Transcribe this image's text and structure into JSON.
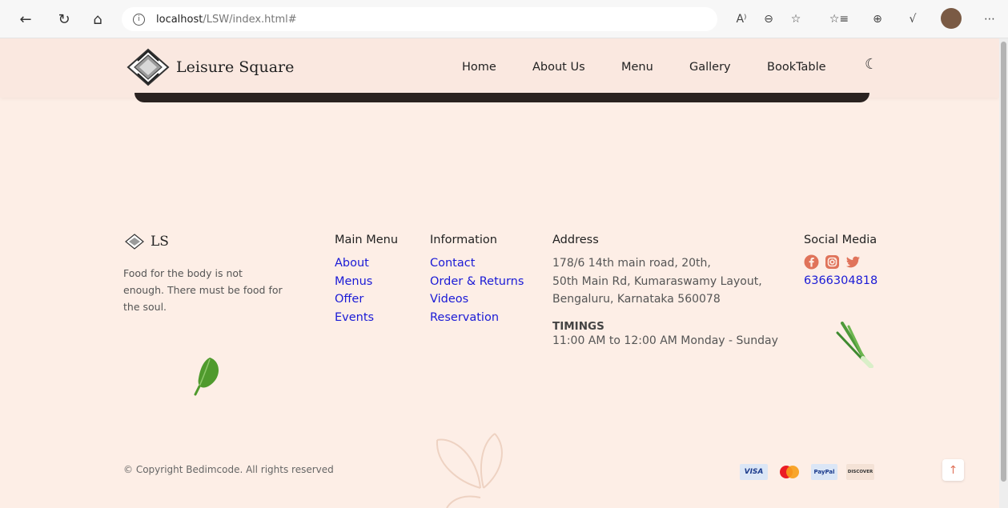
{
  "browser": {
    "url_host": "localhost",
    "url_path": "/LSW/index.html#"
  },
  "header": {
    "brand": "Leisure Square",
    "nav": [
      "Home",
      "About Us",
      "Menu",
      "Gallery",
      "BookTable"
    ]
  },
  "footer": {
    "brand_short": "LS",
    "tagline": "Food for the body is not enough. There must be food for the soul.",
    "main_menu": {
      "title": "Main Menu",
      "links": [
        "About",
        "Menus",
        "Offer",
        "Events"
      ]
    },
    "information": {
      "title": "Information",
      "links": [
        "Contact",
        "Order & Returns",
        "Videos",
        "Reservation"
      ]
    },
    "address": {
      "title": "Address",
      "lines": [
        "178/6 14th main road, 20th,",
        "50th Main Rd, Kumaraswamy Layout,",
        "Bengaluru, Karnataka 560078"
      ],
      "timings_title": "TIMINGS",
      "timings": "11:00 AM to 12:00 AM Monday - Sunday"
    },
    "social": {
      "title": "Social Media",
      "icons": [
        "facebook-icon",
        "instagram-icon",
        "twitter-icon"
      ],
      "phone": "6366304818"
    },
    "copyright": "© Copyright Bedimcode. All rights reserved",
    "payments": [
      "VISA",
      "Mastercard",
      "PayPal",
      "DISCOVER"
    ]
  },
  "colors": {
    "background": "#fdeee6",
    "link": "#1a1ad6",
    "accent": "#e0735a"
  }
}
